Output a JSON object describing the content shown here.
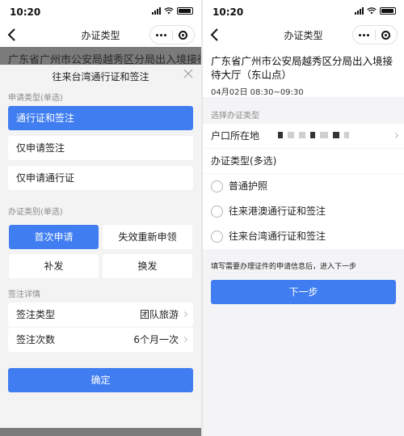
{
  "status_bar": {
    "time": "10:20"
  },
  "left": {
    "nav_title": "办证类型",
    "background_text": "广东省广州市公安局越秀区分局出入境接待大厅",
    "sheet": {
      "title": "往来台湾通行证和签注",
      "apply_type_label": "申请类型(单选)",
      "apply_options": [
        {
          "label": "通行证和签注",
          "selected": true
        },
        {
          "label": "仅申请签注",
          "selected": false
        },
        {
          "label": "仅申请通行证",
          "selected": false
        }
      ],
      "category_label": "办证类别(单选)",
      "category_options": [
        {
          "label": "首次申请",
          "selected": true
        },
        {
          "label": "失效重新申领",
          "selected": false
        },
        {
          "label": "补发",
          "selected": false
        },
        {
          "label": "换发",
          "selected": false
        }
      ],
      "endorsement_label": "签注详情",
      "endorsement_rows": [
        {
          "label": "签注类型",
          "value": "团队旅游"
        },
        {
          "label": "签注次数",
          "value": "6个月一次"
        }
      ],
      "confirm_label": "确定"
    }
  },
  "right": {
    "nav_title": "办证类型",
    "office_name": "广东省广州市公安局越秀区分局出入境接待大厅（东山点）",
    "office_time": "04月02日 08:30~09:30",
    "select_label": "选择办证类型",
    "household_label": "户口所在地",
    "types_label": "办证类型(多选)",
    "types": [
      {
        "label": "普通护照",
        "checked": false
      },
      {
        "label": "往来港澳通行证和签注",
        "checked": false
      },
      {
        "label": "往来台湾通行证和签注",
        "checked": false
      }
    ],
    "hint": "填写需要办理证件的申请信息后，进入下一步",
    "next_label": "下一步"
  },
  "colors": {
    "accent": "#3f7df1",
    "page_bg": "#f3f3f3",
    "dim_overlay": "#7b7b7b"
  }
}
